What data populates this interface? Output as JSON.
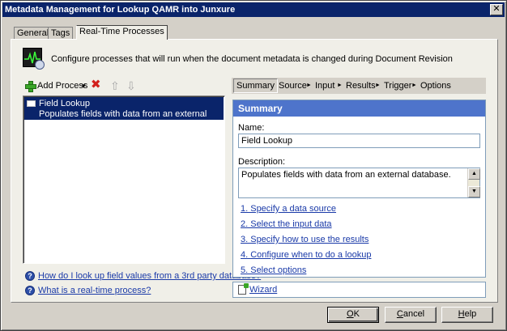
{
  "window": {
    "title": "Metadata Management for Lookup QAMR into Junxure",
    "close_glyph": "✕"
  },
  "tabs": [
    {
      "label": "General",
      "active": false
    },
    {
      "label": "Tags",
      "active": false
    },
    {
      "label": "Real-Time Processes",
      "active": true
    }
  ],
  "intro": {
    "icon": "heartbeat-clock-icon",
    "text": "Configure processes that will run when the document metadata is changed during Document Revision"
  },
  "toolbar": {
    "add_label": "Add Process",
    "add_icon": "plus-icon",
    "dropdown_glyph": "▾",
    "delete_icon": "delete-x-icon",
    "delete_glyph": "✖",
    "up_glyph": "⇧",
    "down_glyph": "⇩"
  },
  "process_list": [
    {
      "title": "Field Lookup",
      "description": "Populates fields with data from an external database.",
      "selected": true
    }
  ],
  "help_links": [
    {
      "text": "How do I look up field values from a 3rd party database?"
    },
    {
      "text": "What is a real-time process?"
    }
  ],
  "help_glyph": "?",
  "breadcrumb": {
    "items": [
      "Summary",
      "Source",
      "Input",
      "Results",
      "Trigger",
      "Options"
    ],
    "active": "Summary",
    "separator": "►"
  },
  "summary": {
    "heading": "Summary",
    "name_label": "Name:",
    "name_value": "Field Lookup",
    "description_label": "Description:",
    "description_value": "Populates fields with data from an external database.",
    "scroll_up": "▲",
    "scroll_down": "▼",
    "steps": [
      "1. Specify a data source",
      "2. Select the input data",
      "3. Specify how to use the results",
      "4. Configure when to do a lookup",
      "5. Select options"
    ]
  },
  "wizard": {
    "label": "Wizard"
  },
  "buttons": {
    "ok": {
      "accel": "O",
      "rest": "K"
    },
    "cancel": {
      "pre": "",
      "accel": "C",
      "rest": "ancel"
    },
    "help": {
      "pre": "",
      "accel": "H",
      "rest": "elp"
    }
  },
  "colors": {
    "title_bar": "#0a246a",
    "summary_header": "#4e74cb",
    "link": "#1a3aa8",
    "selection": "#0a246a"
  }
}
